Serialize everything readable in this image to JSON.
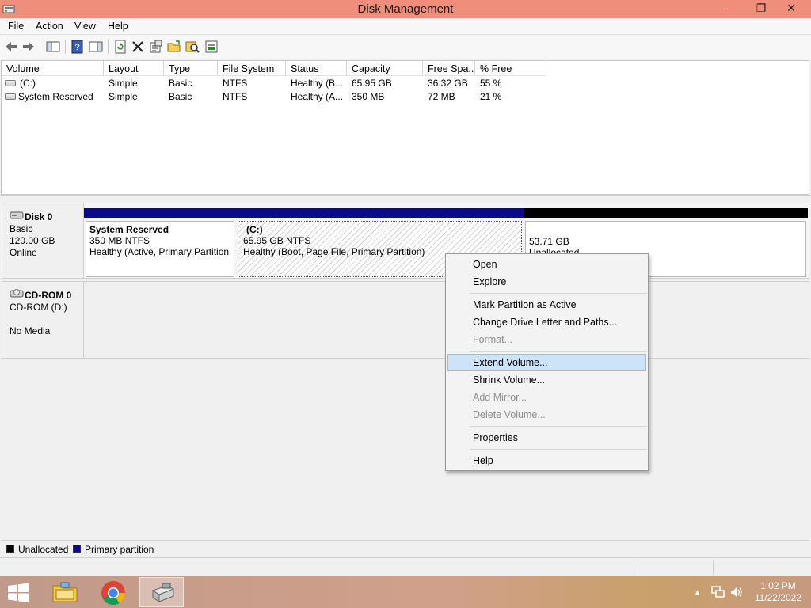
{
  "window": {
    "title": "Disk Management",
    "controls": {
      "minimize": "–",
      "restore": "❐",
      "close": "✕"
    }
  },
  "menubar": {
    "items": [
      "File",
      "Action",
      "View",
      "Help"
    ]
  },
  "toolbar": {
    "icons": [
      "back-arrow-icon",
      "forward-arrow-icon",
      "show-hide-console-tree-icon",
      "help-icon",
      "show-action-pane-icon",
      "refresh-icon",
      "delete-icon",
      "properties-icon",
      "open-icon",
      "explore-icon",
      "rescan-disks-icon"
    ]
  },
  "volume_list": {
    "columns": [
      "Volume",
      "Layout",
      "Type",
      "File System",
      "Status",
      "Capacity",
      "Free Spa...",
      "% Free"
    ],
    "rows": [
      {
        "volume": "(C:)",
        "layout": "Simple",
        "type": "Basic",
        "fs": "NTFS",
        "status": "Healthy (B...",
        "capacity": "65.95 GB",
        "free": "36.32 GB",
        "pct": "55 %"
      },
      {
        "volume": "System Reserved",
        "layout": "Simple",
        "type": "Basic",
        "fs": "NTFS",
        "status": "Healthy (A...",
        "capacity": "350 MB",
        "free": "72 MB",
        "pct": "21 %"
      }
    ]
  },
  "disks": [
    {
      "name": "Disk 0",
      "type": "Basic",
      "size": "120.00 GB",
      "state": "Online",
      "partitions": [
        {
          "name": "System Reserved",
          "size": "350 MB NTFS",
          "status": "Healthy (Active, Primary Partition",
          "bar_color": "#0a0a8a"
        },
        {
          "name": "(C:)",
          "size": "65.95 GB NTFS",
          "status": "Healthy (Boot, Page File, Primary Partition)",
          "bar_color": "#0a0a8a"
        },
        {
          "name": "",
          "size": "53.71 GB",
          "status": "Unallocated",
          "bar_color": "#000000"
        }
      ]
    },
    {
      "name": "CD-ROM 0",
      "type": "CD-ROM (D:)",
      "size": "",
      "state": "No Media"
    }
  ],
  "legend": [
    {
      "label": "Unallocated",
      "color": "#000000"
    },
    {
      "label": "Primary partition",
      "color": "#0a0a8a"
    }
  ],
  "context_menu": {
    "items": [
      {
        "label": "Open",
        "enabled": true
      },
      {
        "label": "Explore",
        "enabled": true
      },
      {
        "label": "Mark Partition as Active",
        "enabled": true
      },
      {
        "label": "Change Drive Letter and Paths...",
        "enabled": true
      },
      {
        "label": "Format...",
        "enabled": false
      },
      {
        "label": "Extend Volume...",
        "enabled": true,
        "highlighted": true
      },
      {
        "label": "Shrink Volume...",
        "enabled": true
      },
      {
        "label": "Add Mirror...",
        "enabled": false
      },
      {
        "label": "Delete Volume...",
        "enabled": false
      },
      {
        "label": "Properties",
        "enabled": true
      },
      {
        "label": "Help",
        "enabled": true
      }
    ]
  },
  "taskbar": {
    "apps": [
      "file-explorer-icon",
      "chrome-icon",
      "disk-management-icon"
    ],
    "clock_time": "1:02 PM",
    "clock_date": "11/22/2022",
    "tray_icons": [
      "show-hidden-icons-icon",
      "network-icon",
      "volume-icon"
    ]
  }
}
